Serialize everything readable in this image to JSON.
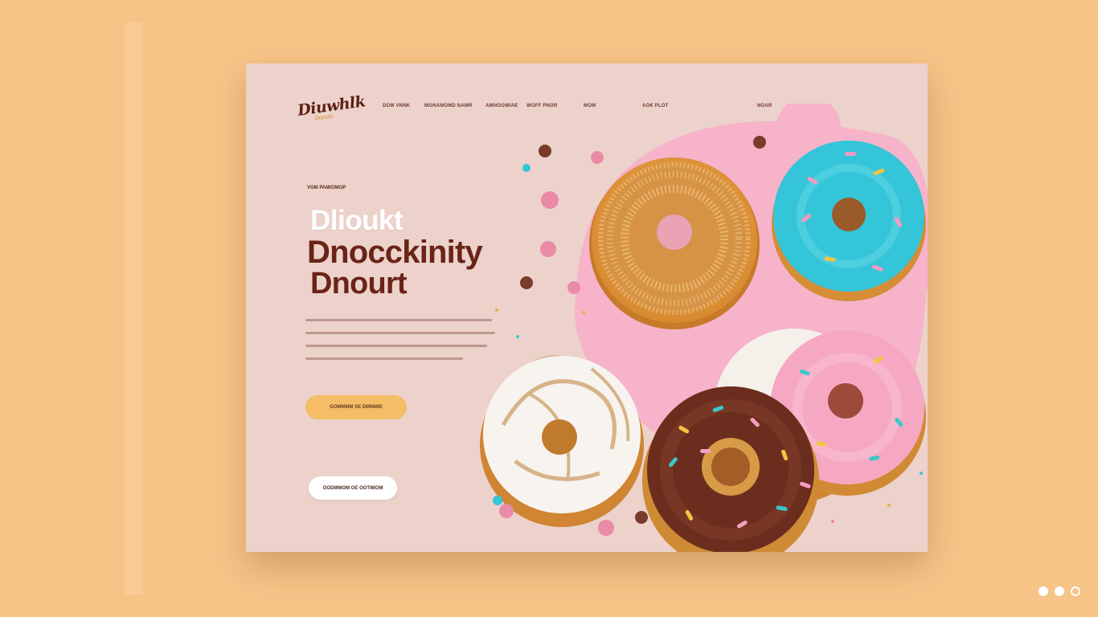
{
  "brand": {
    "logo_text": "Diuwhlk",
    "logo_subtext": "Donuts"
  },
  "nav": {
    "items": [
      {
        "label": "DOM VNNK"
      },
      {
        "label": "MONAMOMD NAMR"
      },
      {
        "label": "AMNOOWIAE"
      },
      {
        "label": "WOFF PNOR"
      },
      {
        "label": "MOM"
      },
      {
        "label": "AOK PLOT"
      },
      {
        "label": "NOAR"
      }
    ]
  },
  "hero": {
    "eyebrow": "VOM PAMIOMOP",
    "line1": "Dlioukt",
    "line2": "Dnocckinity",
    "line3": "Dnourt"
  },
  "buttons": {
    "primary_label": "GOMMMM  SE  DMMMIE",
    "secondary_label": "OODMMOM OE OOTIMOM"
  },
  "colors": {
    "background": "#f7c488",
    "card": "#ecd2cb",
    "brand_dark": "#6a2417",
    "accent": "#f5bd66",
    "pink_splash": "#f6b3c9"
  },
  "icons": [
    "logo-icon",
    "pager-dot"
  ],
  "pager": {
    "count": 3,
    "active_index": 2
  }
}
